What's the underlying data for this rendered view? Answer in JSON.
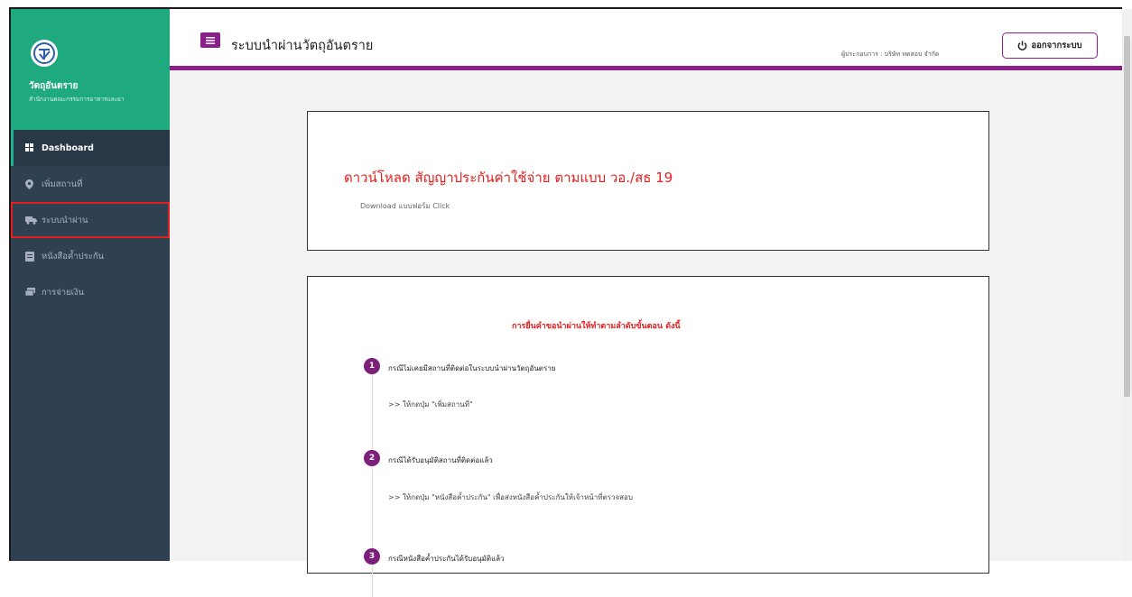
{
  "brand": {
    "title": "วัตถุอันตราย",
    "subtitle": "สำนักงานคณะกรรมการอาหารและยา"
  },
  "sidebar": {
    "items": [
      {
        "label": "Dashboard",
        "icon": "grid-icon"
      },
      {
        "label": "เพิ่มสถานที่",
        "icon": "map-marker-icon"
      },
      {
        "label": "ระบบนำผ่าน",
        "icon": "truck-icon"
      },
      {
        "label": "หนังสือค้ำประกัน",
        "icon": "document-icon"
      },
      {
        "label": "การจ่ายเงิน",
        "icon": "money-icon"
      }
    ]
  },
  "header": {
    "title": "ระบบนำผ่านวัตถุอันตราย",
    "operator": "ผู้ประกอบการ : บริษัท ทดสอบ จำกัด",
    "logout_label": "ออกจากระบบ"
  },
  "download_card": {
    "title": "ดาวน์โหลด สัญญาประกันค่าใช้จ่าย ตามแบบ วอ./สธ 19",
    "link": "Download แบบฟอร์ม Click"
  },
  "steps_card": {
    "title": "การยื่นคำขอนำผ่านให้ทำตามลำดับขั้นตอน ดังนี้",
    "steps": [
      {
        "num": "1",
        "title": "กรณีไม่เคยมีสถานที่ติดต่อในระบบนำผ่านวัตถุอันตราย",
        "desc": ">> ให้กดปุ่ม \"เพิ่มสถานที่\""
      },
      {
        "num": "2",
        "title": "กรณีได้รับอนุมัติสถานที่ติดต่อแล้ว",
        "desc": ">> ให้กดปุ่ม \"หนังสือค้ำประกัน\" เพื่อส่งหนังสือค้ำประกันให้เจ้าหน้าที่ตรวจสอบ"
      },
      {
        "num": "3",
        "title": "กรณีหนังสือค้ำประกันได้รับอนุมัติแล้ว",
        "desc": ""
      }
    ]
  },
  "colors": {
    "sidebar": "#2f4050",
    "brand": "#1fa97f",
    "accent": "#8a1f8a",
    "alert": "#e51e1e",
    "highlight": "#e02020"
  }
}
